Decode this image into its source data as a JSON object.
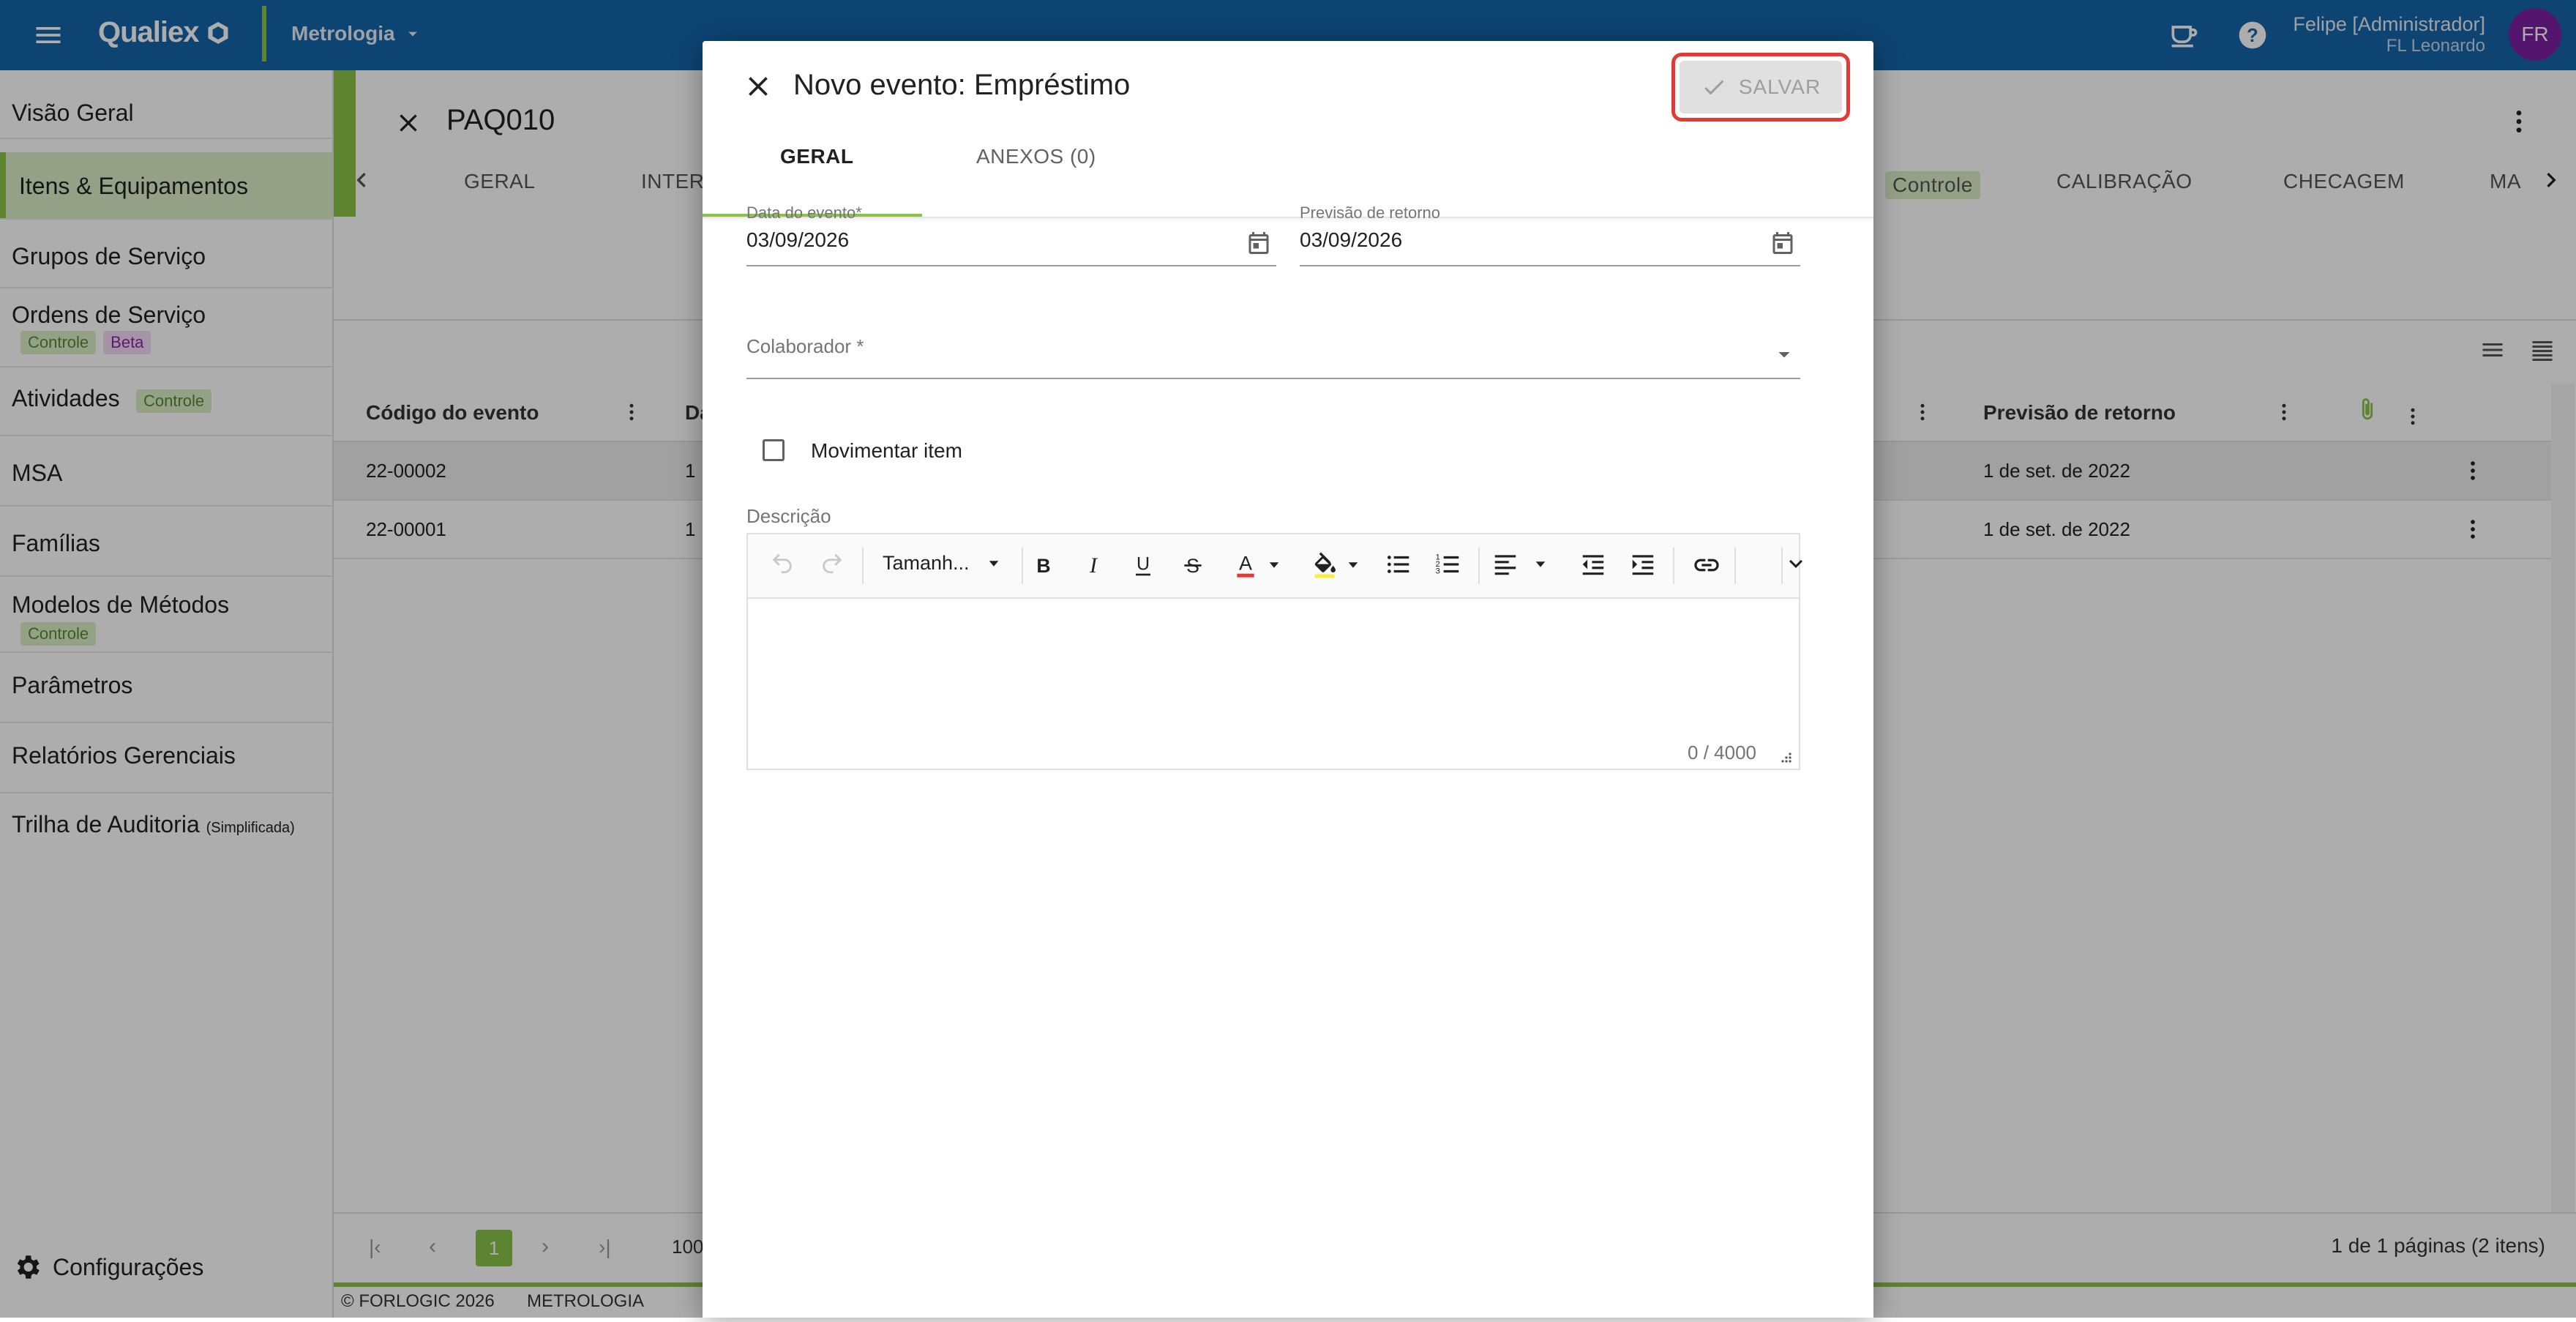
{
  "topbar": {
    "logo": "Qualiex",
    "module": "Metrologia",
    "user_name": "Felipe [Administrador]",
    "user_sub": "FL Leonardo",
    "avatar_initials": "FR"
  },
  "sidebar": {
    "items": [
      {
        "label": "Visão Geral"
      },
      {
        "label": "Itens & Equipamentos"
      },
      {
        "label": "Grupos de Serviço"
      },
      {
        "label": "Ordens de Serviço",
        "tags": [
          "Controle",
          "Beta"
        ]
      },
      {
        "label": "Atividades",
        "tags": [
          "Controle"
        ]
      },
      {
        "label": "MSA"
      },
      {
        "label": "Famílias"
      },
      {
        "label": "Modelos de Métodos",
        "tags": [
          "Controle"
        ]
      },
      {
        "label": "Parâmetros"
      },
      {
        "label": "Relatórios Gerenciais"
      },
      {
        "label": "Trilha de Auditoria",
        "small": "(Simplificada)"
      }
    ],
    "config_label": "Configurações"
  },
  "main": {
    "title": "PAQ010",
    "tabs": [
      "GERAL",
      "INTERV",
      "Controle",
      "CALIBRAÇÃO",
      "CHECAGEM",
      "MA"
    ],
    "columns": [
      "Código do evento",
      "Da",
      "Previsão de retorno"
    ],
    "rows": [
      {
        "code": "22-00002",
        "date": "1",
        "return": "1 de set. de 2022"
      },
      {
        "code": "22-00001",
        "date": "1",
        "return": "1 de set. de 2022"
      }
    ],
    "pager": {
      "current_page": "1",
      "page_size": "100",
      "summary": "1 de 1 páginas (2 itens)"
    },
    "footer": {
      "copyright": "© FORLOGIC 2026",
      "module": "METROLOGIA"
    }
  },
  "dialog": {
    "title": "Novo evento: Empréstimo",
    "save_label": "SALVAR",
    "tabs": [
      "GERAL",
      "ANEXOS (0)"
    ],
    "event_date": {
      "label": "Data do evento*",
      "value": "03/09/2026"
    },
    "return_date": {
      "label": "Previsão de retorno",
      "value": "03/09/2026"
    },
    "collaborator": {
      "label": "Colaborador *",
      "value": ""
    },
    "move_item": {
      "label": "Movimentar item",
      "checked": false
    },
    "description": {
      "label": "Descrição",
      "font_size_select": "Tamanh...",
      "counter": "0 / 4000"
    }
  },
  "colors": {
    "topbar": "#1565a8",
    "accent_green": "#8bc34a",
    "avatar": "#7b1fa2",
    "highlight_red": "#e53935"
  }
}
